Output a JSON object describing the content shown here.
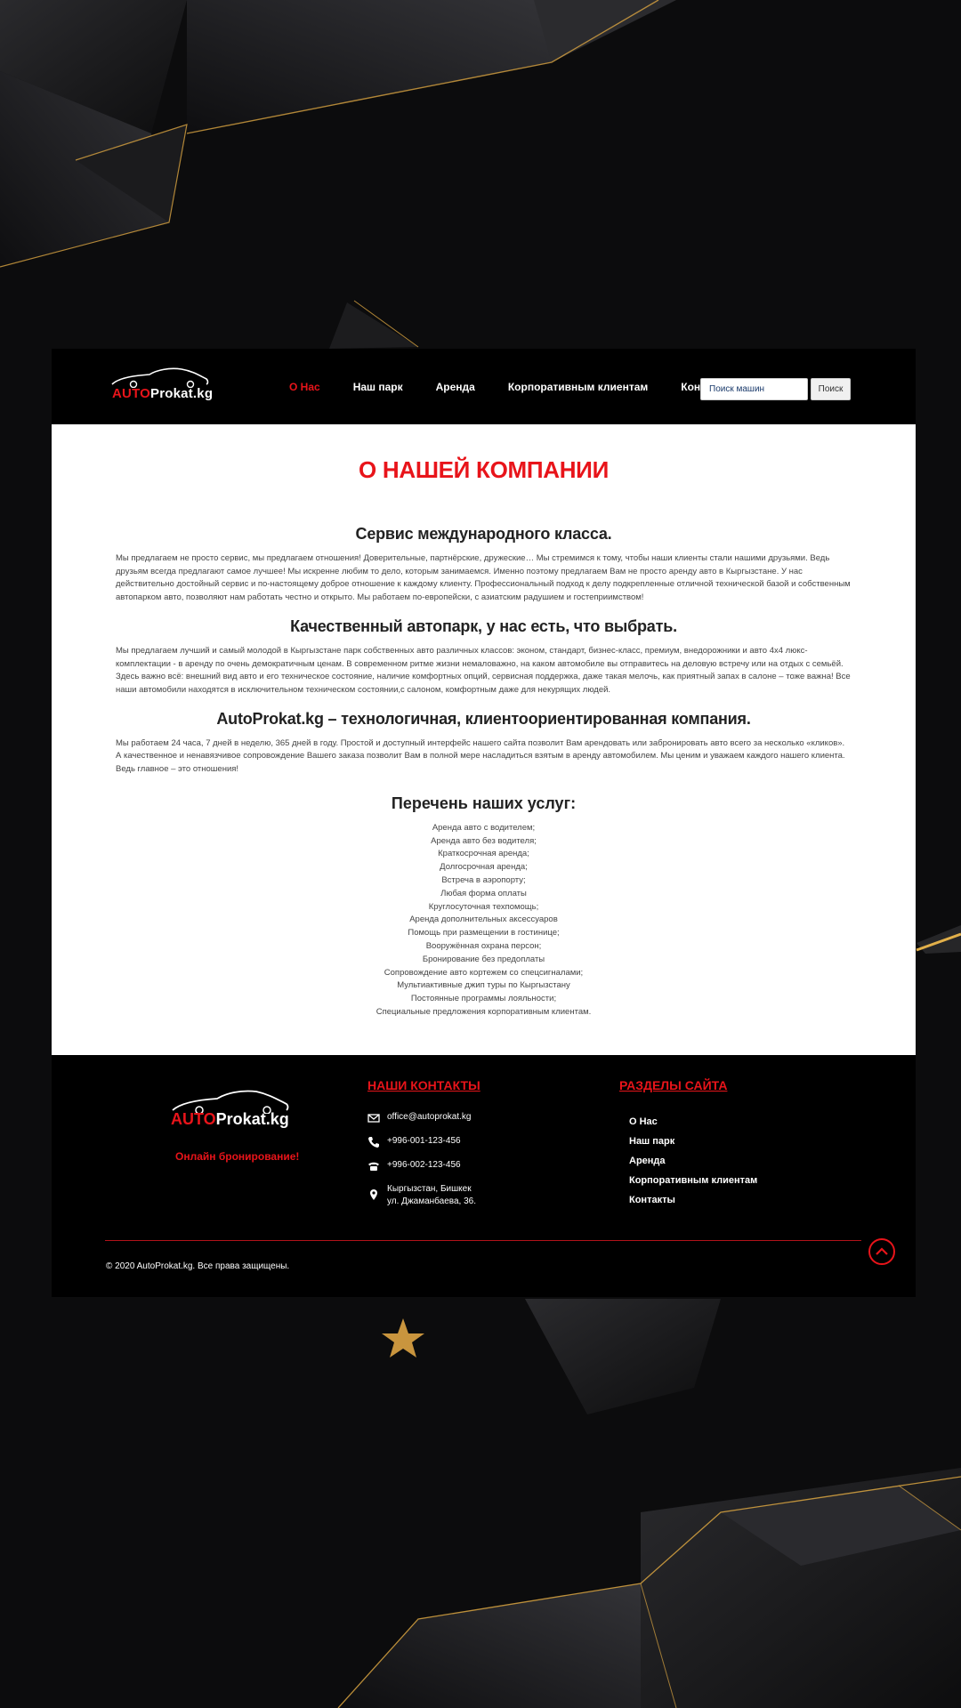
{
  "header": {
    "logo": {
      "auto": "AUTO",
      "rest": "Prokat.kg"
    },
    "nav": [
      "О Нас",
      "Наш парк",
      "Аренда",
      "Корпоративным клиентам",
      "Контакты"
    ],
    "active_nav": "О Нас",
    "search": {
      "placeholder": "Поиск машин",
      "button_label": "Поиск"
    }
  },
  "main": {
    "title": "О НАШЕЙ КОМПАНИИ",
    "sections": [
      {
        "heading": "Сервис международного класса.",
        "text": "Мы предлагаем не просто сервис, мы предлагаем отношения! Доверительные, партнёрские, дружеские… Мы стремимся к тому, чтобы наши клиенты стали нашими друзьями. Ведь друзьям всегда предлагают самое лучшее! Мы искренне любим то дело, которым занимаемся. Именно поэтому предлагаем Вам не просто аренду авто в Кыргызстане. У нас действительно достойный сервис и по-настоящему доброе отношение к каждому клиенту. Профессиональный подход к делу подкрепленные отличной технической базой и собственным автопарком авто, позволяют нам работать честно и открыто. Мы работаем по-европейски, с азиатским радушием и гостеприимством!"
      },
      {
        "heading": "Качественный автопарк, у нас есть, что выбрать.",
        "text": "Мы предлагаем лучший и самый молодой в Кыргызстане парк собственных авто различных классов: эконом, стандарт, бизнес-класс, премиум, внедорожники и авто 4х4 люкс-комплектации - в аренду по очень демократичным ценам. В современном ритме жизни немаловажно, на каком автомобиле вы отправитесь на деловую встречу или на отдых с семьёй. Здесь важно всё: внешний вид авто и его техническое состояние, наличие комфортных опций, сервисная поддержка, даже такая мелочь, как приятный запах в салоне – тоже важна! Все наши автомобили находятся в исключительном техническом состоянии,с салоном, комфортным даже для некурящих людей."
      },
      {
        "heading": "AutoProkat.kg – технологичная, клиентоориентированная компания.",
        "text": "Мы работаем 24 часа, 7 дней в неделю, 365 дней в году. Простой и доступный интерфейс нашего сайта позволит Вам арендовать или забронировать авто всего за несколько «кликов». А качественное и ненавязчивое сопровождение Вашего заказа позволит Вам в полной мере насладиться взятым в аренду автомобилем. Мы ценим и уважаем каждого нашего клиента. Ведь главное – это отношения!"
      }
    ],
    "services_heading": "Перечень наших услуг:",
    "services": [
      "Аренда авто с водителем;",
      "Аренда авто без водителя;",
      "Краткосрочная аренда;",
      "Долгосрочная аренда;",
      "Встреча в аэропорту;",
      "Любая форма оплаты",
      "Круглосуточная техпомощь;",
      "Аренда дополнительных аксессуаров",
      "Помощь при размещении в гостинице;",
      "Вооружённая охрана персон;",
      "Бронирование без предоплаты",
      "Сопровождение авто кортежем со спецсигналами;",
      "Мультиактивные джип туры по Кыргызстану",
      "Постоянные программы лояльности;",
      "Специальные предложения корпоративным клиентам."
    ]
  },
  "footer": {
    "logo": {
      "auto": "AUTO",
      "rest": "Prokat.kg"
    },
    "online_booking": "Онлайн бронирование!",
    "contacts_title": "НАШИ КОНТАКТЫ",
    "email": "office@autoprokat.kg",
    "phone1": "+996-001-123-456",
    "phone2": "+996-002-123-456",
    "address_line1": "Кыргызстан, Бишкек",
    "address_line2": "ул. Джаманбаева, 36.",
    "sections_title": "РАЗДЕЛЫ САЙТА",
    "links": [
      "О Нас",
      "Наш парк",
      "Аренда",
      "Корпоративным клиентам",
      "Контакты"
    ],
    "copyright": "© 2020 AutoProkat.kg. Все права защищены."
  },
  "colors": {
    "accent": "#e8141a",
    "background": "#0b0b0c",
    "gold": "#d9a441"
  }
}
